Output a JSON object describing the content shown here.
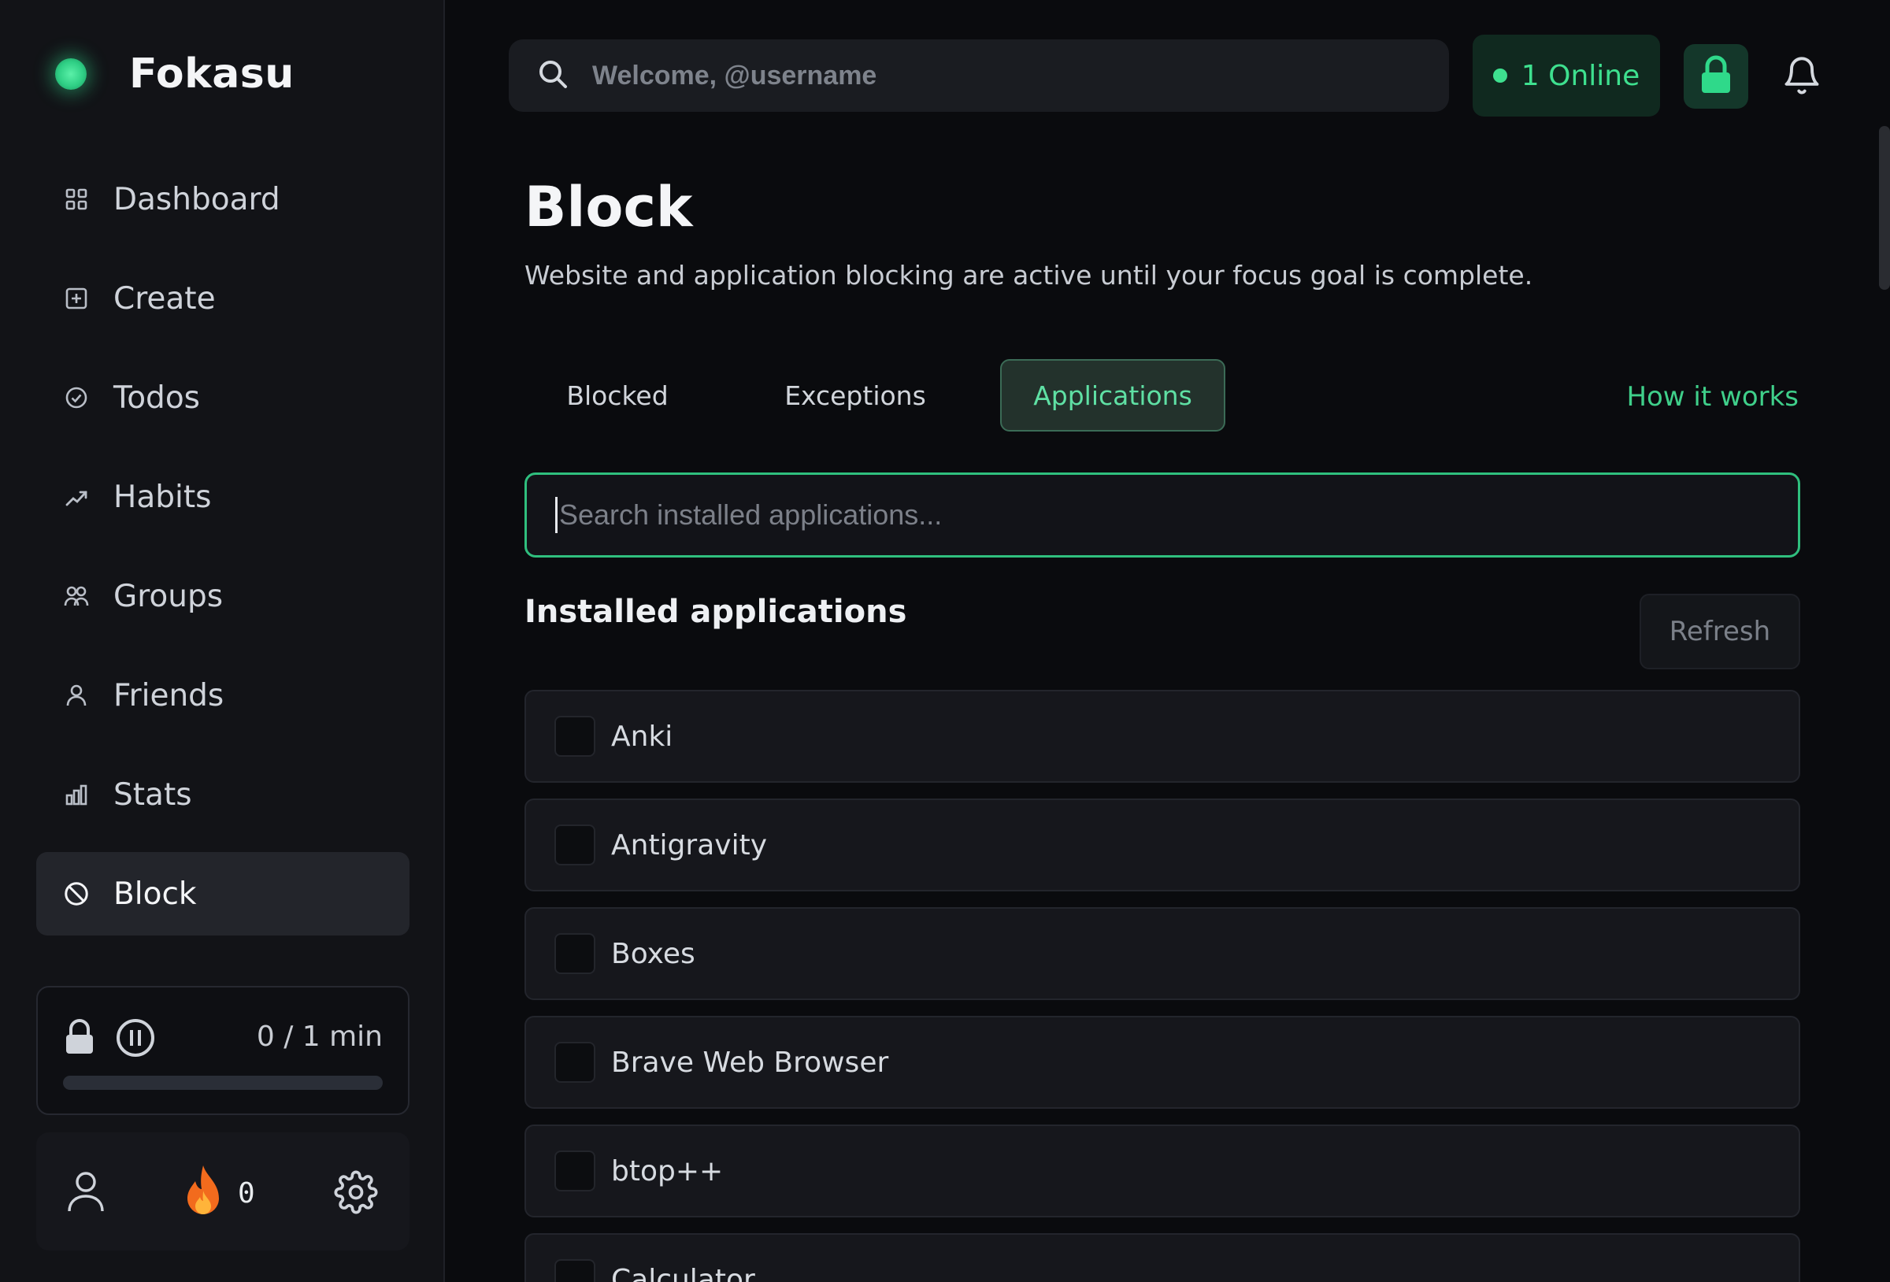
{
  "brand": {
    "name": "Fokasu"
  },
  "sidebar": {
    "items": [
      {
        "label": "Dashboard",
        "icon": "grid-icon"
      },
      {
        "label": "Create",
        "icon": "plus-square-icon"
      },
      {
        "label": "Todos",
        "icon": "check-circle-icon"
      },
      {
        "label": "Habits",
        "icon": "trend-icon"
      },
      {
        "label": "Groups",
        "icon": "users-icon"
      },
      {
        "label": "Friends",
        "icon": "user-icon"
      },
      {
        "label": "Stats",
        "icon": "bar-chart-icon"
      },
      {
        "label": "Block",
        "icon": "block-icon",
        "active": true
      }
    ],
    "timer": {
      "label": "0 / 1 min",
      "progress": 0
    },
    "footer": {
      "streak_count": "0"
    }
  },
  "topbar": {
    "search_placeholder": "Welcome, @username",
    "online_label": "1 Online"
  },
  "main": {
    "title": "Block",
    "description": "Website and application blocking are active until your focus goal is complete.",
    "tabs": [
      {
        "label": "Blocked"
      },
      {
        "label": "Exceptions"
      },
      {
        "label": "Applications",
        "active": true
      }
    ],
    "how_link": "How it works",
    "app_search_placeholder": "Search installed applications...",
    "section_title": "Installed applications",
    "refresh_label": "Refresh",
    "apps": [
      "Anki",
      "Antigravity",
      "Boxes",
      "Brave Web Browser",
      "btop++",
      "Calculator"
    ]
  },
  "colors": {
    "accent": "#2fcf85",
    "background": "#0a0b0e",
    "sidebar": "#121317"
  }
}
